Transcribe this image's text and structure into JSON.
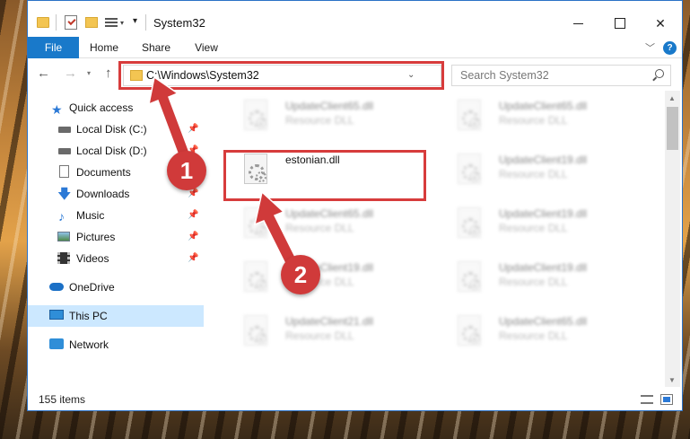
{
  "window": {
    "title": "System32",
    "controls": {
      "minimize": "",
      "maximize": "",
      "close": "✕"
    }
  },
  "ribbon": {
    "tabs": [
      "File",
      "Home",
      "Share",
      "View"
    ],
    "help": "?"
  },
  "navigation": {
    "address": "C:\\Windows\\System32",
    "search_placeholder": "Search System32"
  },
  "sidebar": {
    "items": [
      {
        "label": "Quick access",
        "icon": "star-icon",
        "pinned": false
      },
      {
        "label": "Local Disk (C:)",
        "icon": "disk-icon",
        "pinned": true
      },
      {
        "label": "Local Disk (D:)",
        "icon": "disk-icon",
        "pinned": true
      },
      {
        "label": "Documents",
        "icon": "documents-icon",
        "pinned": true
      },
      {
        "label": "Downloads",
        "icon": "download-icon",
        "pinned": true
      },
      {
        "label": "Music",
        "icon": "music-icon",
        "pinned": true
      },
      {
        "label": "Pictures",
        "icon": "pictures-icon",
        "pinned": true
      },
      {
        "label": "Videos",
        "icon": "videos-icon",
        "pinned": true
      },
      {
        "label": "OneDrive",
        "icon": "onedrive-icon",
        "pinned": false
      },
      {
        "label": "This PC",
        "icon": "pc-icon",
        "pinned": false,
        "selected": true
      },
      {
        "label": "Network",
        "icon": "network-icon",
        "pinned": false
      }
    ]
  },
  "files": {
    "left": [
      {
        "name": "UpdateClient65.dll",
        "type": "Resource DLL",
        "blurred": true
      },
      {
        "name": "estonian.dll",
        "type": "",
        "blurred": false
      },
      {
        "name": "UpdateClient65.dll",
        "type": "Resource DLL",
        "blurred": true
      },
      {
        "name": "UpdateClient19.dll",
        "type": "Resource DLL",
        "blurred": true
      },
      {
        "name": "UpdateClient21.dll",
        "type": "Resource DLL",
        "blurred": true
      }
    ],
    "right": [
      {
        "name": "UpdateClient65.dll",
        "type": "Resource DLL",
        "blurred": true
      },
      {
        "name": "UpdateClient19.dll",
        "type": "Resource DLL",
        "blurred": true
      },
      {
        "name": "UpdateClient19.dll",
        "type": "Resource DLL",
        "blurred": true
      },
      {
        "name": "UpdateClient19.dll",
        "type": "Resource DLL",
        "blurred": true
      },
      {
        "name": "UpdateClient65.dll",
        "type": "Resource DLL",
        "blurred": true
      }
    ]
  },
  "status": {
    "items": "155 items"
  },
  "callouts": {
    "one": "1",
    "two": "2"
  },
  "colors": {
    "accent": "#1979ca",
    "highlight": "#d73c3c",
    "selected": "#cce8ff"
  }
}
